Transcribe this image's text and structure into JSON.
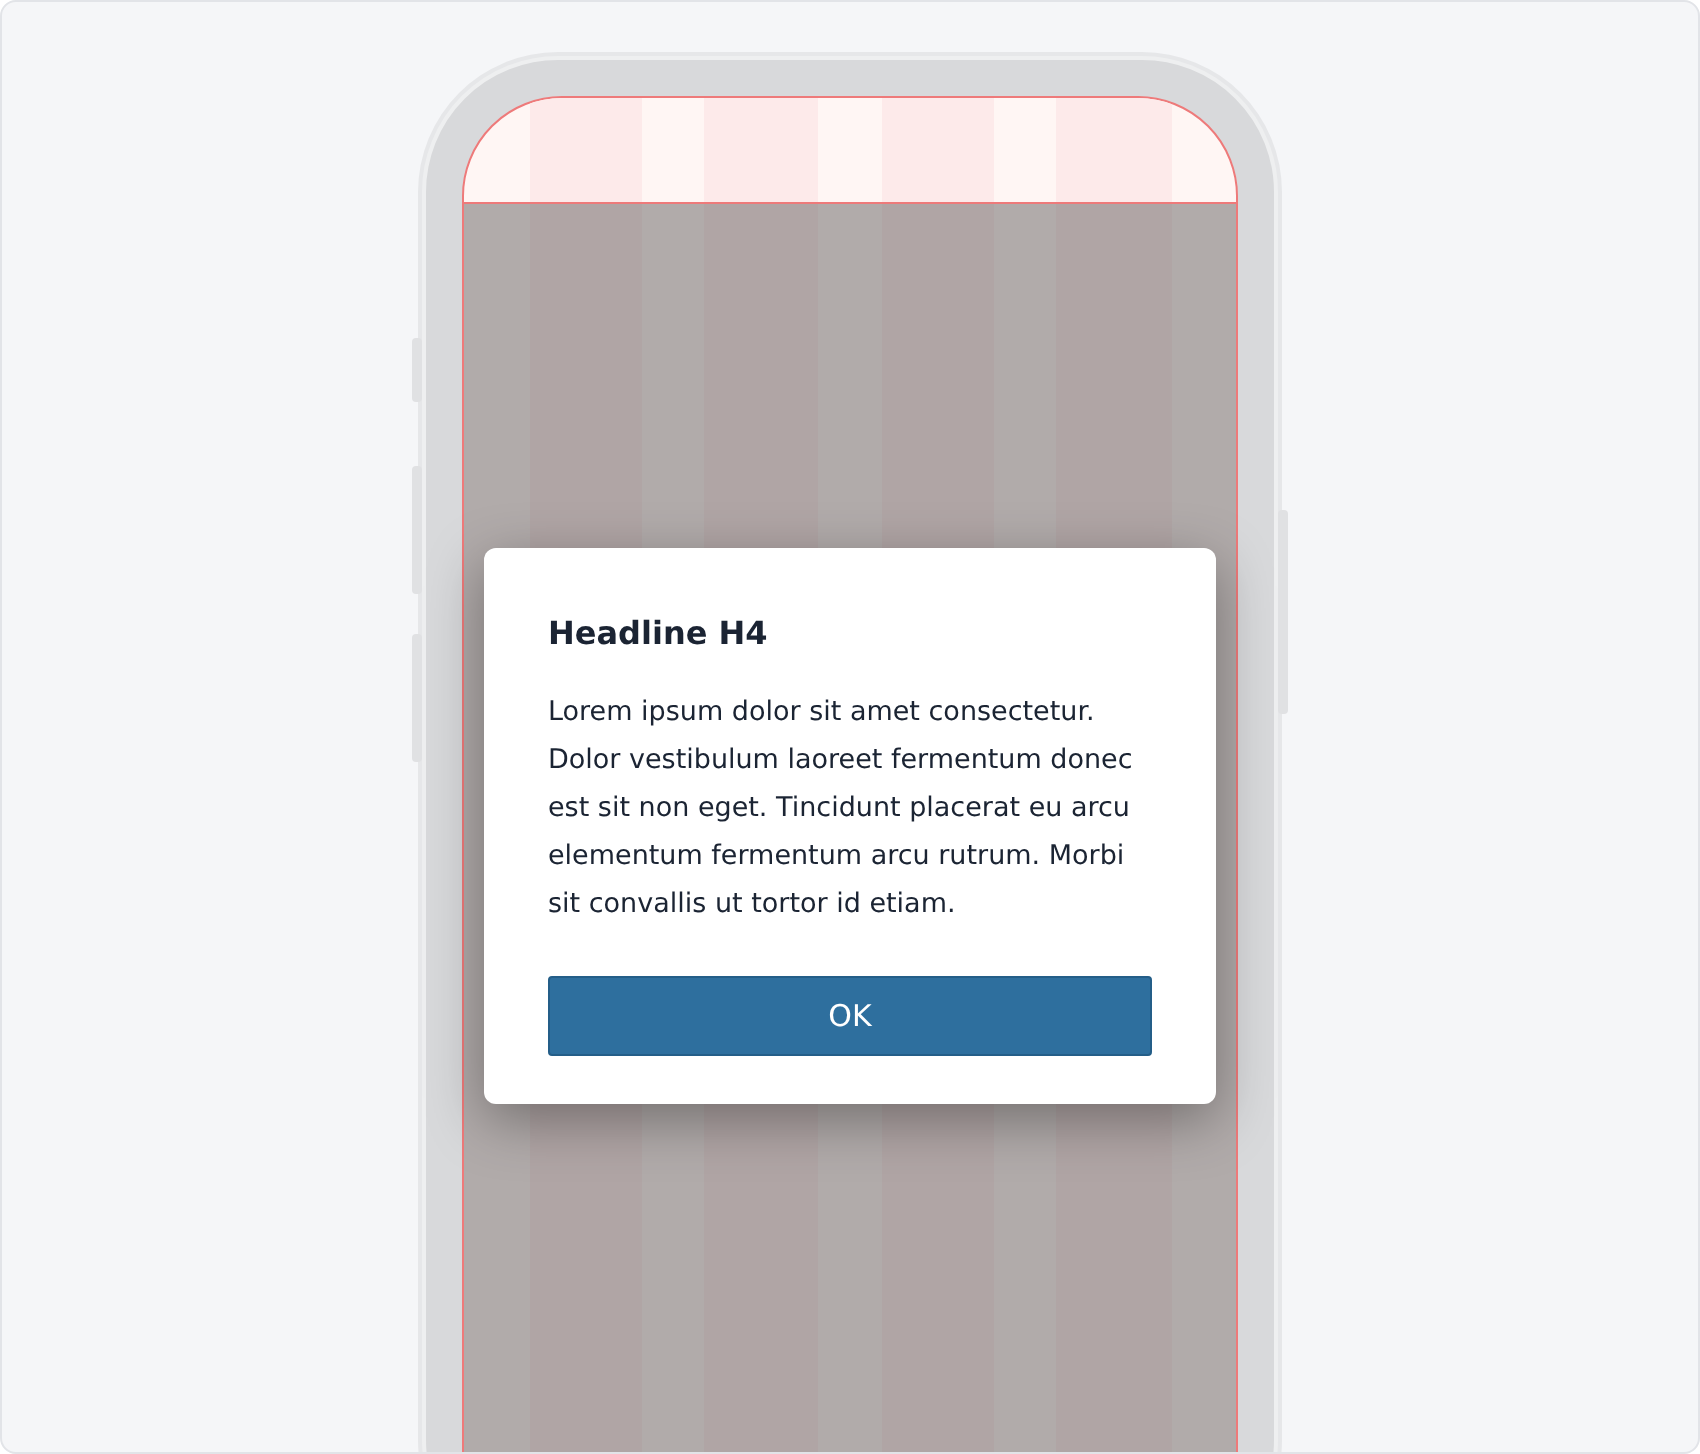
{
  "dialog": {
    "title": "Headline H4",
    "body": "Lorem ipsum dolor sit amet consectetur. Dolor vestibulum laoreet fermentum donec est sit non eget. Tincidunt placerat eu arcu elementum fermentum arcu rutrum. Morbi sit convallis ut tortor id etiam.",
    "buttons": [
      {
        "label": "OK"
      }
    ]
  }
}
